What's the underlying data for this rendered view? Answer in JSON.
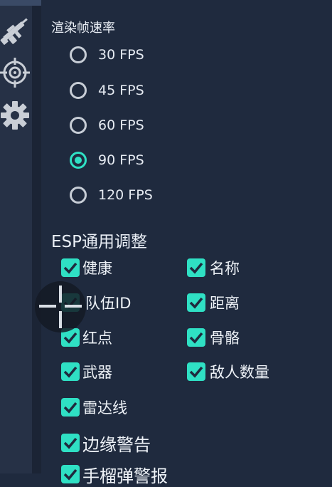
{
  "sidebar": {
    "items": [
      {
        "icon": "rifle-icon"
      },
      {
        "icon": "target-crosshair-icon"
      },
      {
        "icon": "gear-icon"
      }
    ]
  },
  "render_fps": {
    "title": "渲染帧速率",
    "options": [
      "30 FPS",
      "45 FPS",
      "60 FPS",
      "90 FPS",
      "120 FPS"
    ],
    "selected": "90 FPS"
  },
  "esp": {
    "title": "ESP通用调整",
    "left": [
      "健康",
      "队伍ID",
      "红点",
      "武器",
      "雷达线",
      "边缘警告",
      "手榴弹警报"
    ],
    "right": [
      "名称",
      "距离",
      "骨骼",
      "敌人数量"
    ]
  },
  "colors": {
    "accent": "#2fe0c4",
    "background": "#1f2a3e",
    "sidebar": "#263146"
  }
}
